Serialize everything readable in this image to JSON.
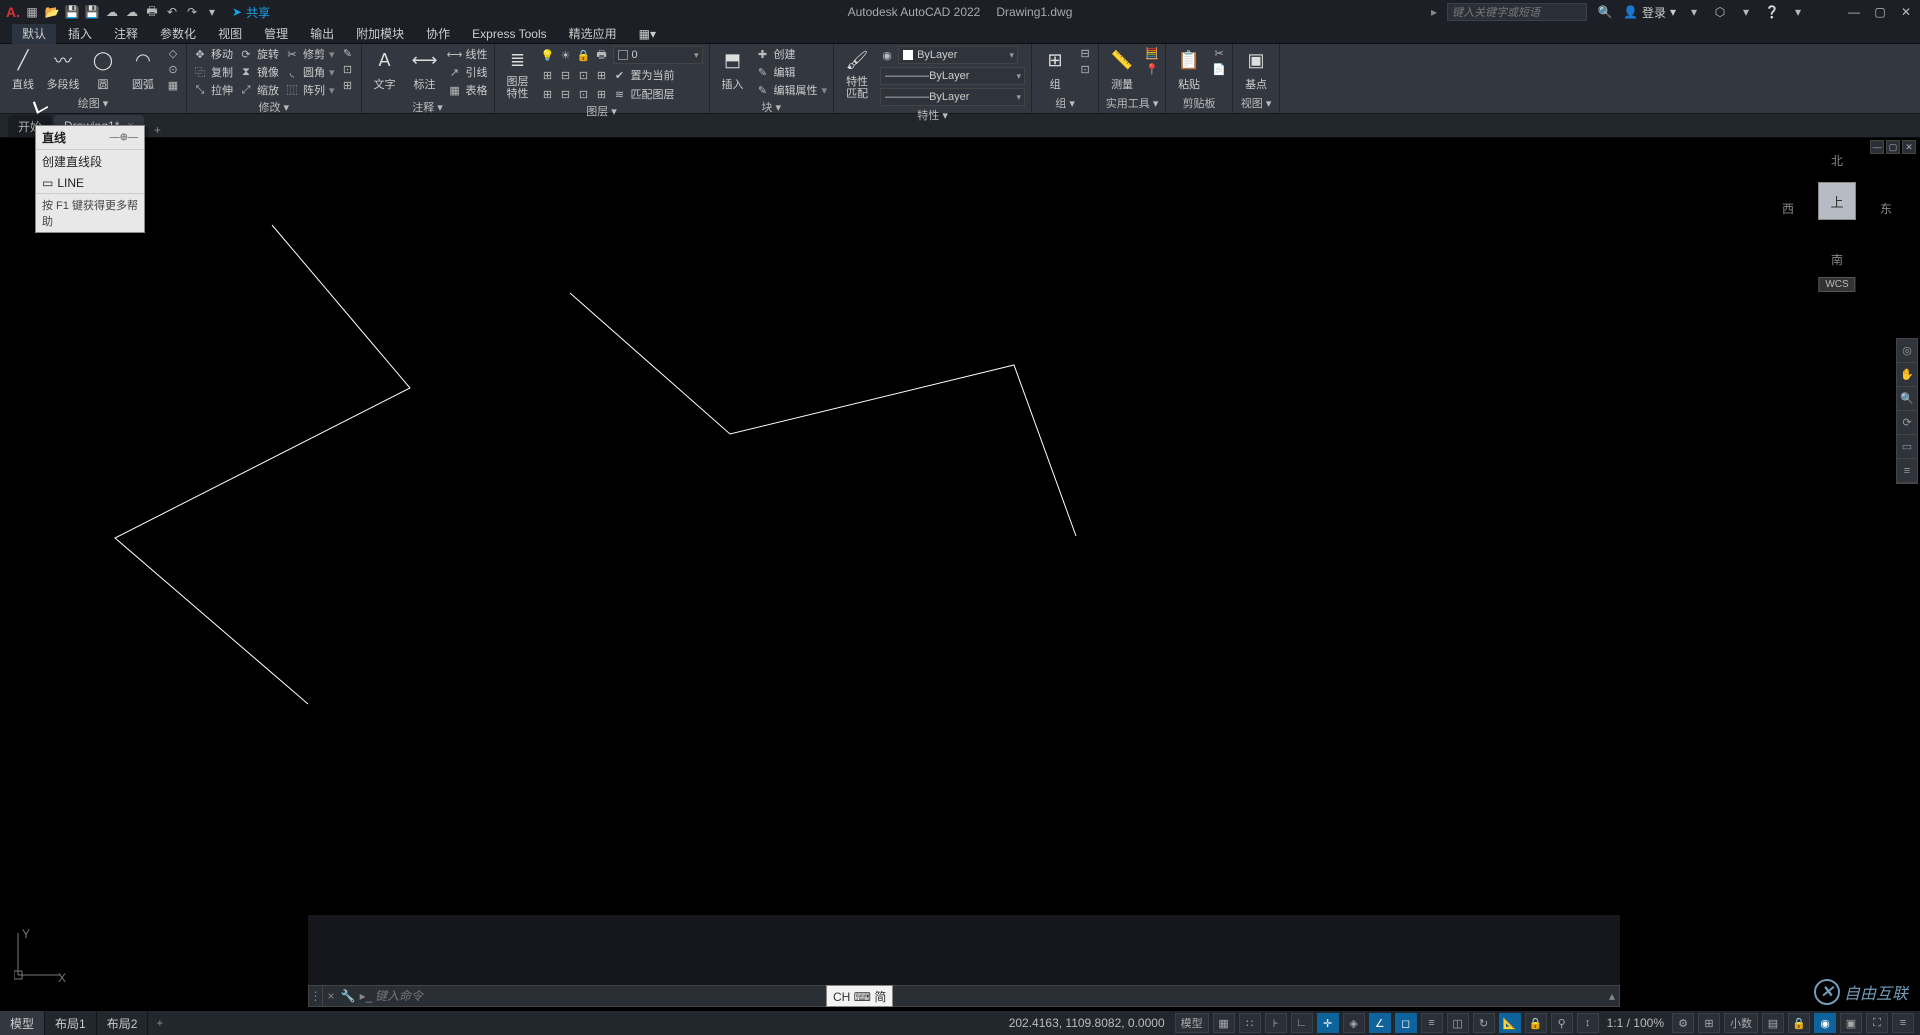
{
  "app": {
    "name": "Autodesk AutoCAD 2022",
    "doc": "Drawing1.dwg"
  },
  "qat": {
    "share": "共享"
  },
  "search": {
    "placeholder": "键入关键字或短语"
  },
  "account": {
    "login": "登录"
  },
  "menutabs": [
    "默认",
    "插入",
    "注释",
    "参数化",
    "视图",
    "管理",
    "输出",
    "附加模块",
    "协作",
    "Express Tools",
    "精选应用"
  ],
  "ribbon": {
    "draw": {
      "title": "绘图 ▾",
      "line": "直线",
      "pline": "多段线",
      "circle": "圆",
      "arc": "圆弧"
    },
    "modify": {
      "title": "修改 ▾",
      "move": "移动",
      "rotate": "旋转",
      "trim": "修剪",
      "copy": "复制",
      "mirror": "镜像",
      "fillet": "圆角",
      "stretch": "拉伸",
      "scale": "缩放",
      "array": "阵列"
    },
    "annot": {
      "title": "注释 ▾",
      "text": "文字",
      "dim": "标注",
      "linear": "线性",
      "leader": "引线",
      "table": "表格"
    },
    "layer": {
      "title": "图层 ▾",
      "props": "图层\n特性",
      "setcur": "置为当前",
      "match": "匹配图层",
      "value": "0"
    },
    "block": {
      "title": "块 ▾",
      "insert": "插入",
      "create": "创建",
      "edit": "编辑",
      "attedit": "编辑属性"
    },
    "prop": {
      "title": "特性 ▾",
      "match": "特性\n匹配",
      "bylayer": "ByLayer"
    },
    "group": {
      "title": "组 ▾",
      "group": "组"
    },
    "util": {
      "title": "实用工具 ▾",
      "measure": "测量"
    },
    "clip": {
      "title": "剪贴板",
      "paste": "粘贴"
    },
    "view": {
      "title": "视图 ▾",
      "base": "基点"
    }
  },
  "doctabs": {
    "start": "开始",
    "drawing": "Drawing1*"
  },
  "tooltip": {
    "title": "直线",
    "desc": "创建直线段",
    "cmd": "LINE",
    "help": "按 F1 键获得更多帮助"
  },
  "viewcube": {
    "n": "北",
    "s": "南",
    "e": "东",
    "w": "西",
    "top": "上",
    "wcs": "WCS"
  },
  "cmd": {
    "placeholder": "键入命令"
  },
  "ime": {
    "text": "CH ⌨ 简"
  },
  "status": {
    "coords": "202.4163, 1109.8082, 0.0000",
    "model": "模型",
    "layout1": "布局1",
    "layout2": "布局2",
    "modelbtn": "模型",
    "scale": "1:1 / 100%",
    "decimal": "小数"
  },
  "watermark": "自由互联"
}
